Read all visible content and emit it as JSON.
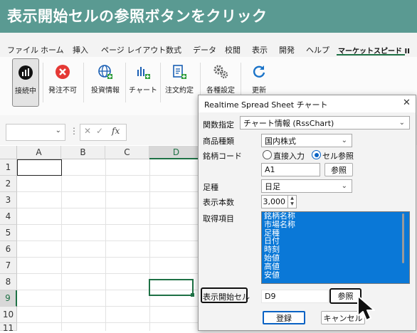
{
  "banner": {
    "title": "表示開始セルの参照ボタンをクリック"
  },
  "menu": {
    "items": [
      "ファイル",
      "ホーム",
      "挿入",
      "ページ レイアウト",
      "数式",
      "データ",
      "校閲",
      "表示",
      "開発",
      "ヘルプ",
      "マーケットスピード II"
    ],
    "active_index": 10
  },
  "ribbon": {
    "buttons": [
      {
        "label": "接続中",
        "icon": "connection-icon"
      },
      {
        "label": "発注不可",
        "icon": "no-order-icon"
      },
      {
        "label": "投資情報",
        "icon": "globe-add-icon"
      },
      {
        "label": "チャート",
        "icon": "chart-add-icon"
      },
      {
        "label": "注文約定",
        "icon": "document-add-icon"
      },
      {
        "label": "各種設定",
        "icon": "gear-icon"
      },
      {
        "label": "更新",
        "icon": "refresh-icon"
      }
    ]
  },
  "formula_bar": {
    "fx": "fx",
    "cancel": "✕",
    "confirm": "✓"
  },
  "grid": {
    "columns": [
      "A",
      "B",
      "C",
      "D"
    ],
    "rows": [
      "1",
      "2",
      "3",
      "4",
      "5",
      "6",
      "7",
      "8",
      "9",
      "10",
      "11"
    ],
    "selected_cell": "D9"
  },
  "dialog": {
    "title": "Realtime Spread Sheet チャート",
    "close": "✕",
    "function_label": "関数指定",
    "function_value": "チャート情報 (RssChart)",
    "product_label": "商品種類",
    "product_value": "国内株式",
    "code_label": "銘柄コード",
    "radio_direct": "直接入力",
    "radio_cell": "セル参照",
    "code_value": "A1",
    "ref_button": "参照",
    "bar_label": "足種",
    "bar_value": "日足",
    "count_label": "表示本数",
    "count_value": "3,000",
    "items_label": "取得項目",
    "items": [
      "銘柄名称",
      "市場名称",
      "足種",
      "日付",
      "時刻",
      "始値",
      "高値",
      "安値"
    ],
    "start_cell_label": "表示開始セル",
    "start_cell_value": "D9",
    "start_ref_button": "参照",
    "register_button": "登録",
    "cancel_button": "キャンセル"
  },
  "colors": {
    "banner": "#5a9a92",
    "accent": "#1e7145",
    "selection": "#0a78d7",
    "stop": "#e53935"
  }
}
